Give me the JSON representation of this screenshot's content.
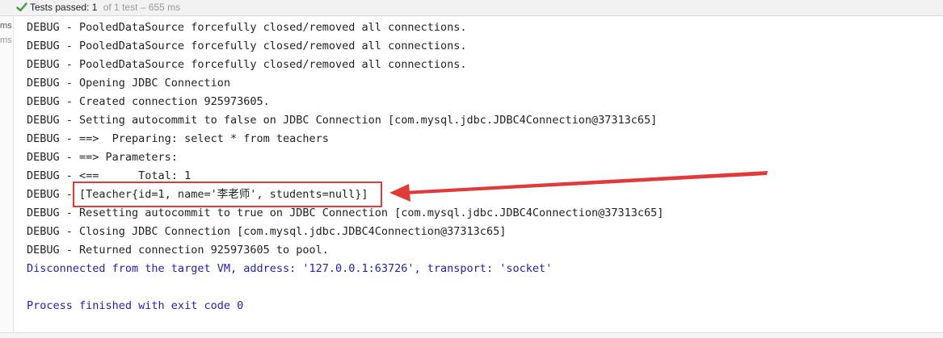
{
  "status_bar": {
    "passed_label": "Tests passed:",
    "passed_count": "1",
    "detail": "of 1 test – 655 ms"
  },
  "gutter": {
    "label_1": "ms",
    "label_2": "ms"
  },
  "console": {
    "lines": [
      "DEBUG - PooledDataSource forcefully closed/removed all connections.",
      "DEBUG - PooledDataSource forcefully closed/removed all connections.",
      "DEBUG - PooledDataSource forcefully closed/removed all connections.",
      "DEBUG - Opening JDBC Connection",
      "DEBUG - Created connection 925973605.",
      "DEBUG - Setting autocommit to false on JDBC Connection [com.mysql.jdbc.JDBC4Connection@37313c65]",
      "DEBUG - ==>  Preparing: select * from teachers",
      "DEBUG - ==> Parameters: ",
      "DEBUG - <==      Total: 1",
      "DEBUG - [Teacher{id=1, name='李老师', students=null}]",
      "DEBUG - Resetting autocommit to true on JDBC Connection [com.mysql.jdbc.JDBC4Connection@37313c65]",
      "DEBUG - Closing JDBC Connection [com.mysql.jdbc.JDBC4Connection@37313c65]",
      "DEBUG - Returned connection 925973605 to pool.",
      "Disconnected from the target VM, address: '127.0.0.1:63726', transport: 'socket'",
      "",
      "Process finished with exit code 0"
    ]
  },
  "colors": {
    "status_check": "#3c9a3c",
    "console_text": "#222222",
    "system_text": "#1f1fa8",
    "annotation": "#e13a3a"
  },
  "icons": {
    "status": "check-icon"
  }
}
